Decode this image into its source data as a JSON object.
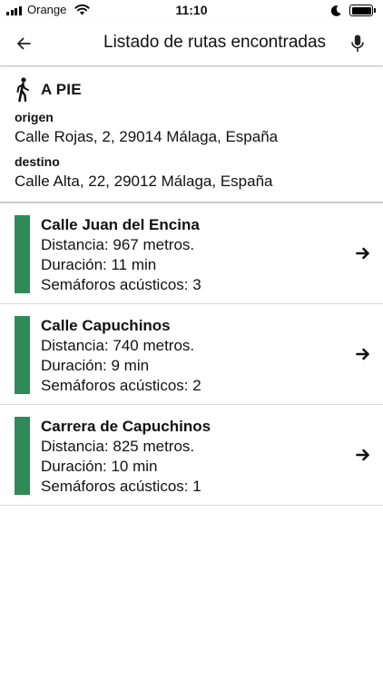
{
  "status_bar": {
    "carrier": "Orange",
    "time": "11:10"
  },
  "header": {
    "title": "Listado de rutas encontradas",
    "back_icon": "arrow-left-icon",
    "mic_icon": "microphone-icon"
  },
  "mode": {
    "icon": "walking-person-icon",
    "label": "A PIE"
  },
  "origin": {
    "label": "origen",
    "value": "Calle Rojas, 2, 29014 Málaga, España"
  },
  "destination": {
    "label": "destino",
    "value": "Calle Alta, 22, 29012 Málaga, España"
  },
  "route_color": "#2e8b57",
  "routes": [
    {
      "name": "Calle Juan del Encina",
      "distance": "Distancia: 967 metros.",
      "duration": "Duración: 11 min",
      "signals": "Semáforos acústicos: 3"
    },
    {
      "name": "Calle Capuchinos",
      "distance": "Distancia: 740 metros.",
      "duration": "Duración: 9 min",
      "signals": "Semáforos acústicos: 2"
    },
    {
      "name": "Carrera de Capuchinos",
      "distance": "Distancia: 825 metros.",
      "duration": "Duración: 10 min",
      "signals": "Semáforos acústicos: 1"
    }
  ]
}
